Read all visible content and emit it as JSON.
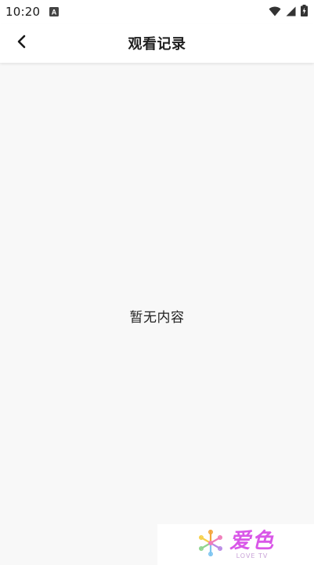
{
  "status_bar": {
    "time": "10:20",
    "app_icon_letter": "A"
  },
  "nav": {
    "title": "观看记录",
    "back_icon": "chevron-left-icon"
  },
  "content": {
    "empty_message": "暂无内容"
  },
  "watermark": {
    "brand": "爱色",
    "subtitle": "LOVE TV"
  },
  "colors": {
    "background": "#f8f8f8",
    "header": "#ffffff",
    "brand_pink": "#d957e8"
  }
}
